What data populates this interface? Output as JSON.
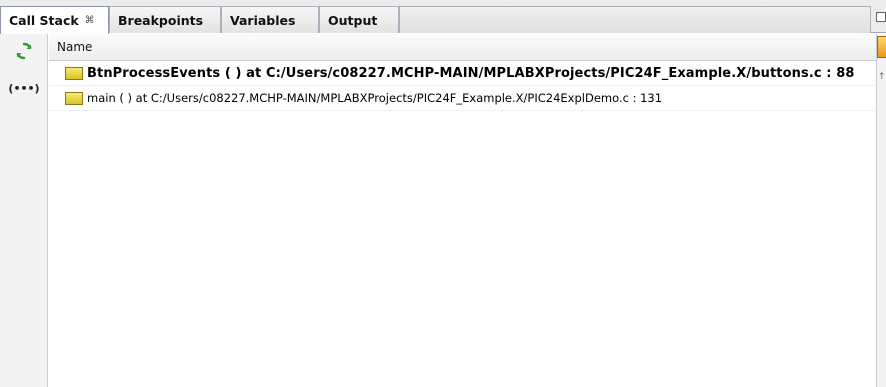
{
  "tabs": [
    {
      "label": "Call Stack",
      "close": "⌘"
    },
    {
      "label": "Breakpoints"
    },
    {
      "label": "Variables"
    },
    {
      "label": "Output"
    }
  ],
  "toolbar": {
    "refresh_icon": "refresh-icon",
    "format_icon_label": "(•••)"
  },
  "table": {
    "column_header": "Name",
    "rows": [
      {
        "text": "BtnProcessEvents ( ) at C:/Users/c08227.MCHP-MAIN/MPLABXProjects/PIC24F_Example.X/buttons.c : 88",
        "current": true
      },
      {
        "text": "main ( ) at C:/Users/c08227.MCHP-MAIN/MPLABXProjects/PIC24F_Example.X/PIC24ExplDemo.c : 131",
        "current": false
      }
    ]
  },
  "scrollbar": {
    "tick": "↑"
  },
  "colors": {
    "frame_icon": "#e6d33c",
    "tab_border": "#a9b1bd",
    "refresh_green": "#2e9b32"
  }
}
